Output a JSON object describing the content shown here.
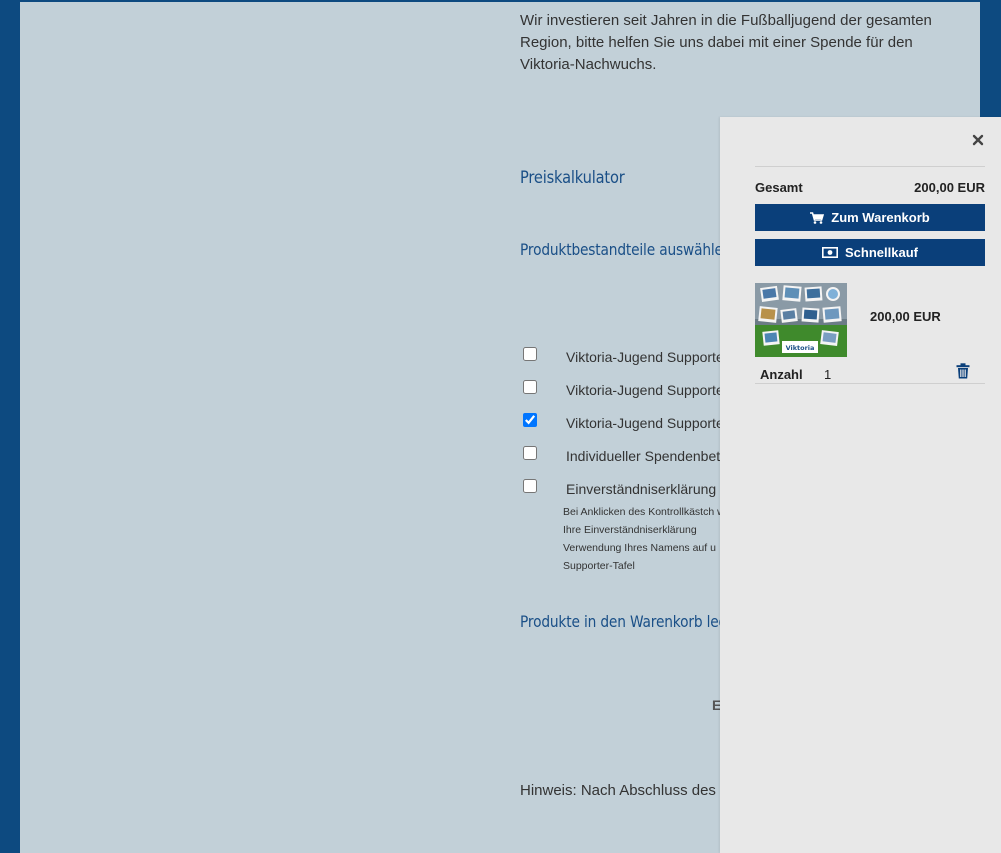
{
  "page": {
    "intro_text": "Wir investieren seit Jahren in die Fußballjugend der gesamten Region, bitte helfen Sie uns dabei mit einer Spende für den Viktoria-Nachwuchs.",
    "calculator_heading": "Preiskalkulator",
    "select_heading": "Produktbestandteile auswählen",
    "options": [
      {
        "label": "Viktoria-Jugend Supporte",
        "checked": false
      },
      {
        "label": "Viktoria-Jugend Supporte",
        "checked": false
      },
      {
        "label": "Viktoria-Jugend Supporte",
        "checked": true
      },
      {
        "label": "Individueller Spendenbet",
        "checked": false
      },
      {
        "label": "Einverständniserklärung",
        "checked": false
      }
    ],
    "consent_note": "Bei Anklicken des Kontrollkästch wir Ihre Einverständniserklärung Verwendung Ihres Namens auf u Supporter-Tafel",
    "cart_heading": "Produkte in den Warenkorb leger",
    "fragment_e": "E",
    "hint_text": "Hinweis: Nach Abschluss des E-Mail eine automatisierte Sp"
  },
  "cart": {
    "total_label": "Gesamt",
    "total_value": "200,00 EUR",
    "to_cart_label": "Zum Warenkorb",
    "quick_buy_label": "Schnellkauf",
    "item": {
      "price": "200,00 EUR",
      "qty_label": "Anzahl",
      "qty": "1",
      "thumb_text": "Viktoria"
    }
  },
  "colors": {
    "frame": "#0d4a80",
    "page_bg": "#c2d0d8",
    "heading": "#1a4f87",
    "button": "#0a3f7a",
    "panel_bg": "#e8e8e8"
  },
  "icons": {
    "close": "close-icon",
    "cart": "cart-icon",
    "cash": "cash-icon",
    "trash": "trash-icon",
    "checkbox_checked": "check-icon"
  }
}
